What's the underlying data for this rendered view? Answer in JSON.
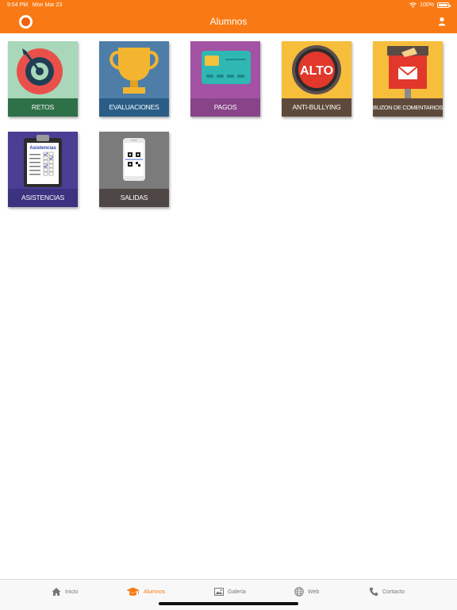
{
  "status_bar": {
    "time": "9:04 PM",
    "date": "Mon Mar 23",
    "battery": "100%"
  },
  "nav": {
    "title": "Alumnos"
  },
  "tiles": [
    {
      "label": "RETOS",
      "icon": "target-icon",
      "bg": "#a8d8b9",
      "label_bg": "#2e7048"
    },
    {
      "label": "EVALUACIONES",
      "icon": "trophy-icon",
      "bg": "#4e7ea8",
      "label_bg": "#2a5d86"
    },
    {
      "label": "PAGOS",
      "icon": "credit-card-icon",
      "bg": "#a452a3",
      "label_bg": "#884488"
    },
    {
      "label": "ANTI-BULLYING",
      "icon": "stop-sign-icon",
      "bg": "#f7be3c",
      "label_bg": "#5e4a3c"
    },
    {
      "label": "BUZON DE COMENTARIOS",
      "icon": "mailbox-icon",
      "bg": "#f7be3c",
      "label_bg": "#5e4a3c"
    },
    {
      "label": "ASISTENCIAS",
      "icon": "clipboard-icon",
      "bg": "#4a3f95",
      "label_bg": "#3b3280"
    },
    {
      "label": "SALIDAS",
      "icon": "qr-phone-icon",
      "bg": "#7b7b7b",
      "label_bg": "#4f4646"
    }
  ],
  "tile_art": {
    "stop_text": "ALTO",
    "clipboard_title": "Asistencias"
  },
  "tabs": [
    {
      "label": "Inicio",
      "icon": "home-icon",
      "active": false
    },
    {
      "label": "Alumnos",
      "icon": "graduation-cap-icon",
      "active": true
    },
    {
      "label": "Galería",
      "icon": "gallery-icon",
      "active": false
    },
    {
      "label": "Web",
      "icon": "globe-icon",
      "active": false
    },
    {
      "label": "Contacto",
      "icon": "phone-icon",
      "active": false
    }
  ],
  "colors": {
    "accent": "#f97a14",
    "tab_inactive": "#777777"
  }
}
